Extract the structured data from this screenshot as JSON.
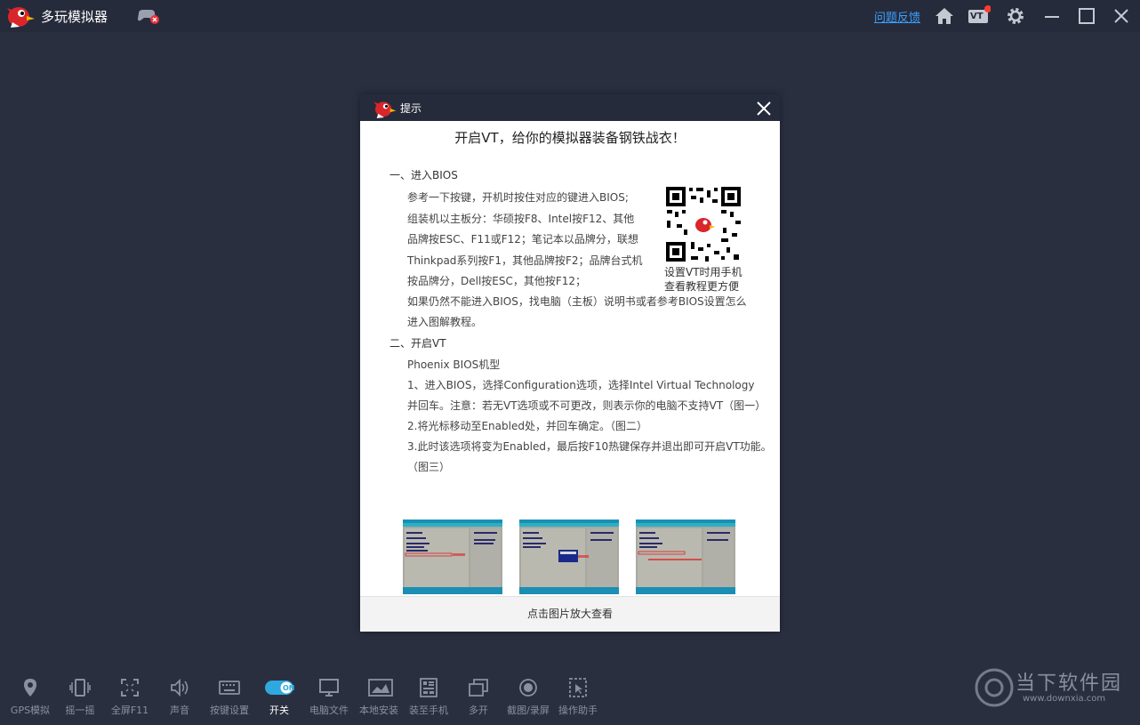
{
  "app": {
    "title": "多玩模拟器",
    "feedback_link": "问题反馈",
    "vt_badge": "VT"
  },
  "dialog": {
    "title": "提示",
    "heading": "开启VT，给你的模拟器装备钢铁战衣！",
    "section1_title": "一、进入BIOS",
    "section1_lines": [
      "参考一下按键，开机时按住对应的键进入BIOS;",
      "组装机以主板分：华硕按F8、Intel按F12、其他",
      "品牌按ESC、F11或F12；笔记本以品牌分，联想",
      "Thinkpad系列按F1，其他品牌按F2；品牌台式机",
      "按品牌分，Dell按ESC，其他按F12；",
      "如果仍然不能进入BIOS，找电脑（主板）说明书或者参考BIOS设置怎么",
      "进入图解教程。"
    ],
    "qr_caption": [
      "设置VT时用手机",
      "查看教程更方便"
    ],
    "section2_title": "二、开启VT",
    "section2_lines": [
      "Phoenix BIOS机型",
      "1、进入BIOS，选择Configuration选项，选择Intel Virtual Technology",
      "并回车。注意：若无VT选项或不可更改，则表示你的电脑不支持VT（图一）",
      "2.将光标移动至Enabled处，并回车确定。（图二）",
      "3.此时该选项将变为Enabled，最后按F10热键保存并退出即可开启VT功能。",
      "（图三）"
    ],
    "footer": "点击图片放大查看"
  },
  "toolbar": {
    "items": [
      {
        "label": "GPS模拟",
        "icon": "location-pin-icon"
      },
      {
        "label": "摇一摇",
        "icon": "shake-icon"
      },
      {
        "label": "全屏F11",
        "icon": "fullscreen-icon"
      },
      {
        "label": "声音",
        "icon": "speaker-icon"
      },
      {
        "label": "按键设置",
        "icon": "keyboard-icon"
      },
      {
        "label": "开关",
        "icon": "toggle-on-icon",
        "toggle_text": "ON"
      },
      {
        "label": "电脑文件",
        "icon": "monitor-icon"
      },
      {
        "label": "本地安装",
        "icon": "install-icon"
      },
      {
        "label": "装至手机",
        "icon": "phone-install-icon"
      },
      {
        "label": "多开",
        "icon": "multi-window-icon"
      },
      {
        "label": "截图/录屏",
        "icon": "record-icon"
      },
      {
        "label": "操作助手",
        "icon": "assistant-icon"
      }
    ]
  },
  "watermark": {
    "text": "当下软件园",
    "url": "www.downxia.com"
  },
  "colors": {
    "background": "#2a2f40",
    "titlebar": "#262b3b",
    "accent": "#3aa0ff",
    "toggle": "#2fa8e0",
    "notification": "#ff3b30"
  }
}
